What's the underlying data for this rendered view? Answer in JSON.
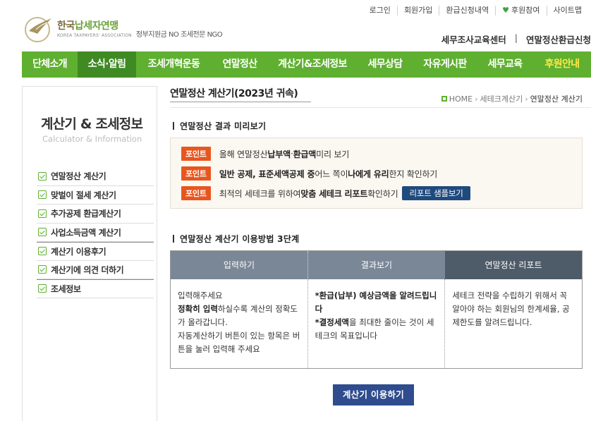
{
  "utility_links": [
    "로그인",
    "회원가입",
    "환급신청내역",
    "후원참여",
    "사이트맵"
  ],
  "logo": {
    "name_part1": "한국",
    "name_part2": "납세자연맹",
    "name_en": "KOREA TAXPAYERS' ASSOCIATION",
    "slogan": "정부지원금 NO 조세전문 NGO"
  },
  "sub_links": [
    "세무조사교육센터",
    "연말정산환급신청"
  ],
  "main_nav": [
    {
      "label": "단체소개"
    },
    {
      "label": "소식·알림"
    },
    {
      "label": "조세개혁운동"
    },
    {
      "label": "연말정산"
    },
    {
      "label": "계산기&조세정보"
    },
    {
      "label": "세무상담"
    },
    {
      "label": "자유게시판"
    },
    {
      "label": "세무교육"
    },
    {
      "label": "후원안내"
    }
  ],
  "sidebar": {
    "title": "계산기 & 조세정보",
    "subtitle": "Calculator & Information",
    "items": [
      {
        "label": "연말정산 계산기"
      },
      {
        "label": "맞벌이 절세 계산기"
      },
      {
        "label": "추가공제 환급계산기"
      },
      {
        "label": "사업소득금액 계산기"
      },
      {
        "label": "계산기 이용후기"
      },
      {
        "label": "계산기에 의견 더하기"
      },
      {
        "label": "조세정보"
      }
    ]
  },
  "page": {
    "title": "연말정산 계산기(2023년 귀속)",
    "breadcrumb": [
      "HOME",
      "세테크계산기",
      "연말정산 계산기"
    ]
  },
  "preview": {
    "heading": "연말정산 결과 미리보기",
    "badge": "포인트",
    "rows": [
      {
        "t1": "올해 연말정산 ",
        "b1": "납부액",
        "t2": " · ",
        "b2": "환급액",
        "t3": " 미리 보기"
      },
      {
        "b1": "일반 공제, 표준세액공제 중",
        "t1": " 어느 쪽이 ",
        "b2": "나에게 유리",
        "t2": "한지 확인하기"
      },
      {
        "t1": "최적의 세테크를 위하여 ",
        "b1": "맞춤 세테크 리포트",
        "t2": " 확인하기"
      }
    ],
    "sample_button": "리포트 샘플보기"
  },
  "steps": {
    "heading": "연말정산 계산기 이용방법 3단계",
    "cols": [
      {
        "head": "입력하기",
        "lines": [
          "입력해주세요"
        ],
        "bold": "정확히 입력",
        "after_bold": "하실수록 계산의 정확도가 올라갑니다.",
        "extra": "자동계산하기 버튼이 있는 항목은 버튼을 눌러 입력해 주세요"
      },
      {
        "head": "결과보기",
        "b1": "*환급(납부) 예상금액을 알려드립니다",
        "b2": "*결정세액",
        "t2": "을 최대한 줄이는 것이 세테크의 목표입니다"
      },
      {
        "head": "연말정산 리포트",
        "text": "세테크 전략을 수립하기 위해서 꼭 알아야 하는 회원님의 한계세율, 공제한도를 알려드립니다."
      }
    ]
  },
  "cta_button": "계산기 이용하기",
  "colors": {
    "nav_green": "#5fb030",
    "nav_active": "#3f8a22",
    "nav_highlight": "#ffe94a",
    "point_orange": "#e8561f",
    "button_blue": "#2e4c8e"
  }
}
